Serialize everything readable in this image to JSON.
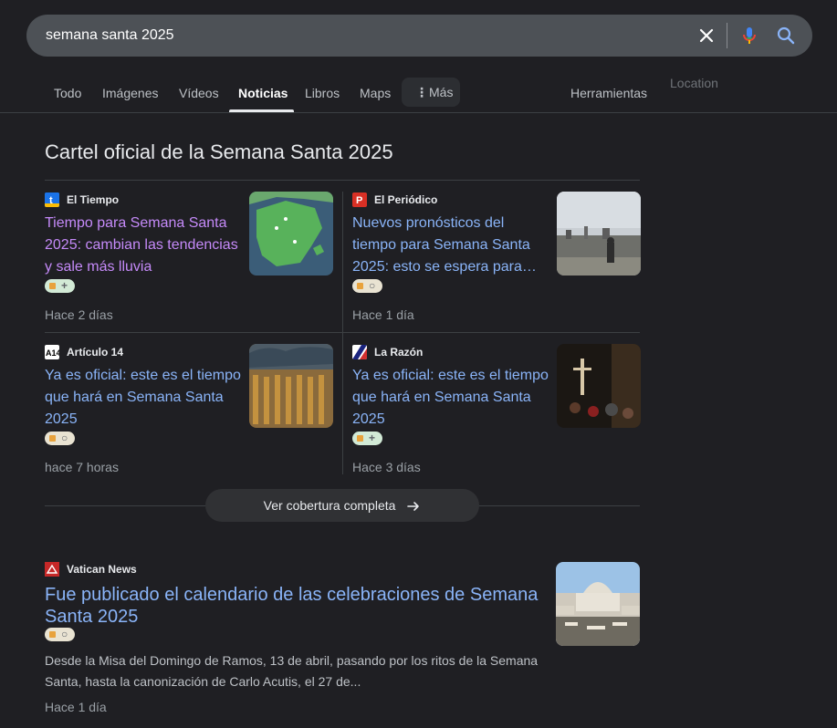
{
  "search": {
    "query": "semana santa 2025"
  },
  "tabs": {
    "items": [
      {
        "label": "Todo"
      },
      {
        "label": "Imágenes"
      },
      {
        "label": "Vídeos"
      },
      {
        "label": "Noticias",
        "active": true
      },
      {
        "label": "Libros"
      },
      {
        "label": "Maps"
      }
    ],
    "more_label": "Más",
    "tools_label": "Herramientas",
    "location_label": "Location"
  },
  "top_stories": {
    "title": "Cartel oficial de la Semana Santa 2025",
    "cards": [
      {
        "source": "El Tiempo",
        "headline": "Tiempo para Semana Santa 2025: cambian las tendencias y sale más lluvia",
        "time": "Hace 2 días",
        "thumb": "map-thumbnail",
        "favicon_color": "#1a73e8"
      },
      {
        "source": "El Periódico",
        "headline": "Nuevos pronósticos del tiempo para Semana Santa 2025: esto se espera para…",
        "time": "Hace 1 día",
        "thumb": "city-skyline-thumbnail",
        "favicon_color": "#d93025"
      },
      {
        "source": "Artículo 14",
        "headline": "Ya es oficial: este es el tiempo que hará en Semana Santa 2025",
        "time": "hace 7 horas",
        "thumb": "procession-thumbnail",
        "favicon_color": "#ffffff"
      },
      {
        "source": "La Razón",
        "headline": "Ya es oficial: este es el tiempo que hará en Semana Santa 2025",
        "time": "Hace 3 días",
        "thumb": "night-procession-thumbnail",
        "favicon_color": "#1a237e"
      }
    ],
    "coverage_label": "Ver cobertura completa"
  },
  "result": {
    "source": "Vatican News",
    "headline": "Fue publicado el calendario de las celebraciones de Semana Santa 2025",
    "snippet": "Desde la Misa del Domingo de Ramos, 13 de abril, pasando por los ritos de la Semana Santa, hasta la canonización de Carlo Acutis, el 27 de...",
    "time": "Hace 1 día",
    "thumb": "st-peters-square-thumbnail"
  },
  "colors": {
    "background": "#1f1f23",
    "link": "#8ab4f8",
    "visited_link": "#c58af9",
    "search_bar": "#4d5156"
  }
}
